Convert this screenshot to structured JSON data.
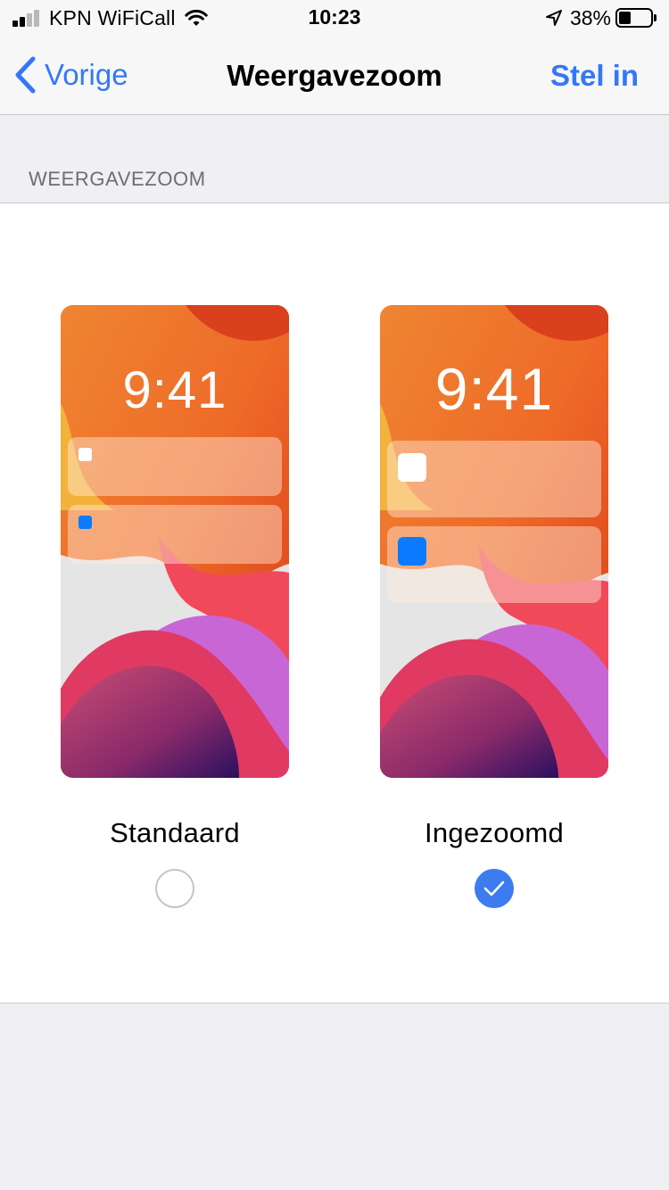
{
  "status_bar": {
    "carrier": "KPN WiFiCall",
    "time": "10:23",
    "battery_percent": "38%",
    "battery_level": 0.38,
    "signal_bars_active": 2,
    "signal_bars_total": 4,
    "icons": [
      "signal-bars-icon",
      "wifi-icon",
      "location-arrow-icon",
      "battery-icon"
    ]
  },
  "nav": {
    "back_label": "Vorige",
    "title": "Weergavezoom",
    "action_label": "Stel in"
  },
  "section": {
    "header": "WEERGAVEZOOM"
  },
  "options": [
    {
      "label": "Standaard",
      "preview_time": "9:41",
      "selected": false
    },
    {
      "label": "Ingezoomd",
      "preview_time": "9:41",
      "selected": true
    }
  ],
  "colors": {
    "accent": "#3478f6",
    "radio_selected": "#3d7bf0",
    "notification_icon_blue": "#0a7bff",
    "background": "#efeff4",
    "section_header": "#6d6d72"
  }
}
